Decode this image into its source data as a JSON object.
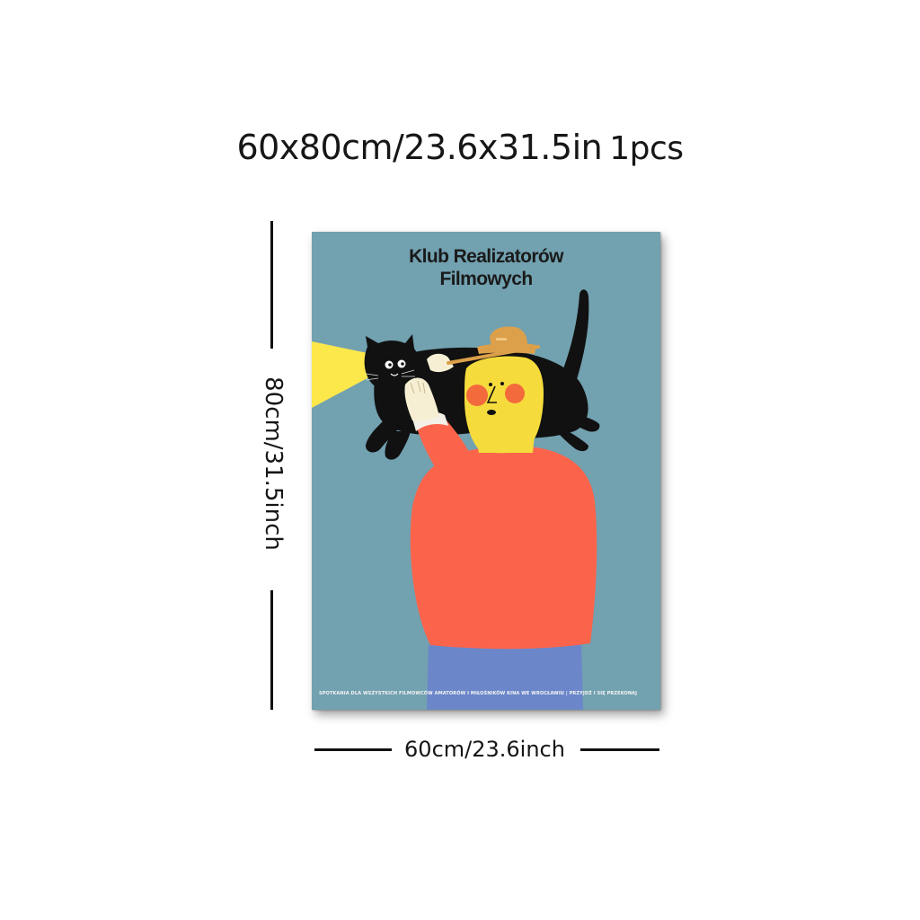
{
  "header": {
    "size_text": "60x80cm/23.6x31.5in",
    "quantity_text": "1pcs"
  },
  "dimensions": {
    "height_label": "80cm/31.5inch",
    "width_label": "60cm/23.6inch"
  },
  "poster": {
    "title_line1": "Klub Realizatorów",
    "title_line2": "Filmowych",
    "footer": "SPOTKANIA DLA WSZYSTKICH  FILMOWCÓW AMATORÓW I MIŁOŚNIKÓW KINA WE WROCŁAWIU  |  PRZYJDŹ I SIĘ PRZEKONAJ",
    "colors": {
      "background": "#72a1b0",
      "sweater": "#fb644b",
      "trousers": "#6b86c9",
      "face": "#f5dc3c",
      "cheeks": "#f36a3c",
      "hat": "#dca04a",
      "cat": "#111111",
      "light_beam": "#fde84c"
    }
  }
}
